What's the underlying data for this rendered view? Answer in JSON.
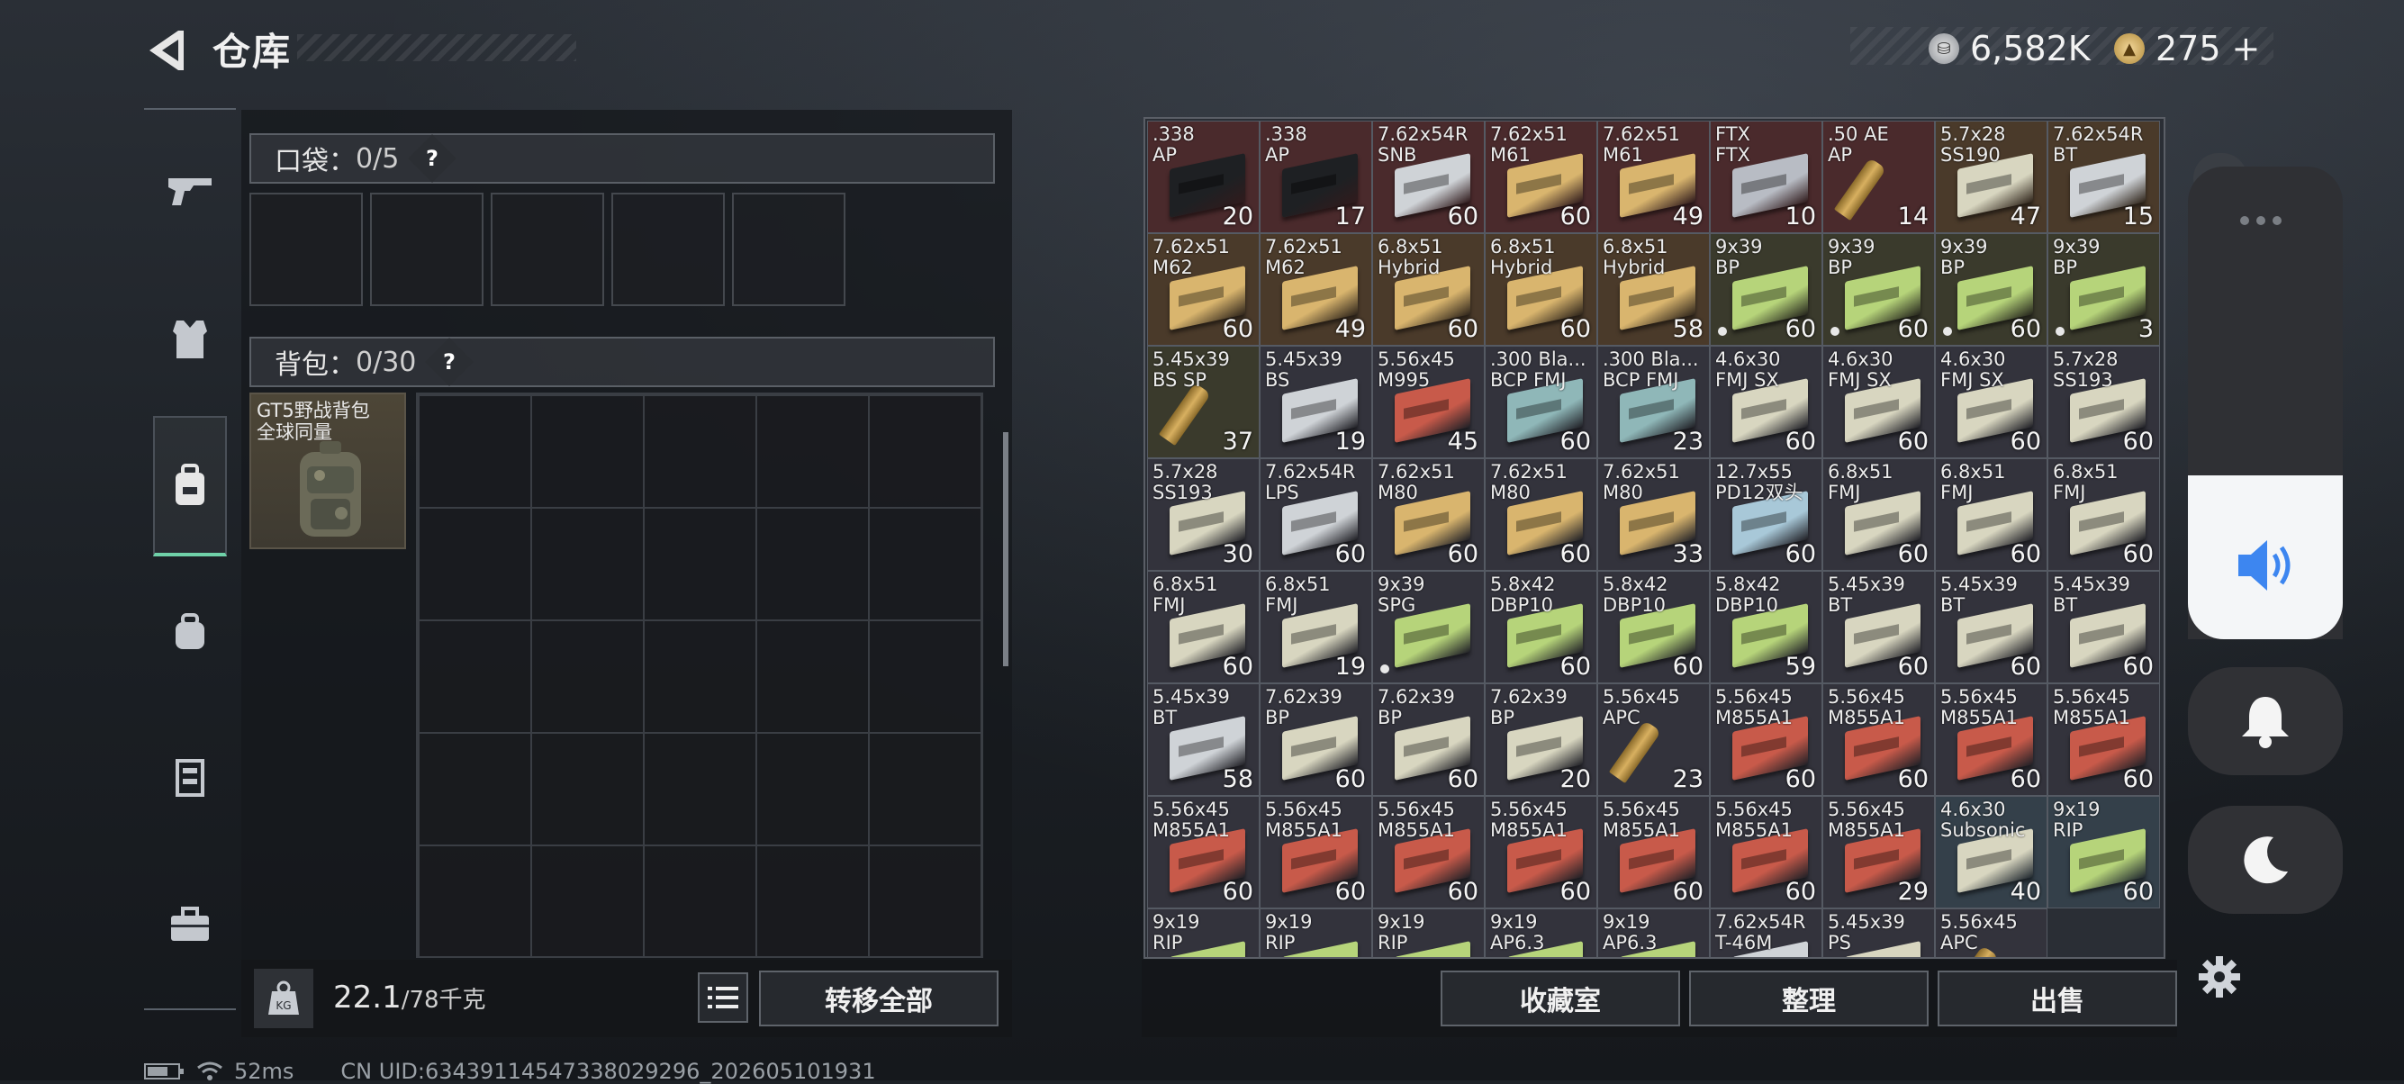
{
  "header": {
    "title": "仓库"
  },
  "currency": {
    "silver": "6,582K",
    "gold": "275",
    "plus": "+"
  },
  "pocket": {
    "label": "口袋：",
    "count": "0/5",
    "help": "?"
  },
  "backpack": {
    "label": "背包：",
    "count": "0/30",
    "help": "?",
    "item_name": "GT5野战背包\n全球同量"
  },
  "weight": {
    "current": "22.1",
    "max": "/78千克"
  },
  "buttons": {
    "transfer_all": "转移全部",
    "collection": "收藏室",
    "sort": "整理",
    "sell": "出售"
  },
  "status": {
    "ping": "52ms",
    "uid": "CN UID:634391145473380292​96_202605101931"
  },
  "ammo": [
    {
      "name": ".338\nAP",
      "count": "20",
      "color": "#1e2023",
      "bg": "#4a2a2c"
    },
    {
      "name": ".338\nAP",
      "count": "17",
      "color": "#1e2023",
      "bg": "#4a2a2c"
    },
    {
      "name": "7.62x54R\nSNB",
      "count": "60",
      "color": "#cfd3d7",
      "bg": "#4a2a2c"
    },
    {
      "name": "7.62x51\nM61",
      "count": "60",
      "color": "#d9b56e",
      "bg": "#4a2a2c"
    },
    {
      "name": "7.62x51\nM61",
      "count": "49",
      "color": "#d9b56e",
      "bg": "#4a2a2c"
    },
    {
      "name": "FTX\nFTX",
      "count": "10",
      "color": "#b8bcc4",
      "bg": "#4a2a2c"
    },
    {
      "name": ".50 AE\nAP",
      "count": "14",
      "color": "round",
      "bg": "#4a2a2c"
    },
    {
      "name": "5.7x28\nSS190",
      "count": "47",
      "color": "#d8d6c0",
      "bg": "#4a3a2a"
    },
    {
      "name": "7.62x54R\nBT",
      "count": "15",
      "color": "#cfd3d7",
      "bg": "#4a3a2a"
    },
    {
      "name": "7.62x51\nM62",
      "count": "60",
      "color": "#d9b56e",
      "bg": "#4a3a2a"
    },
    {
      "name": "7.62x51\nM62",
      "count": "49",
      "color": "#d9b56e",
      "bg": "#4a3a2a"
    },
    {
      "name": "6.8x51\nHybrid",
      "count": "60",
      "color": "#d9b56e",
      "bg": "#4a3a2a"
    },
    {
      "name": "6.8x51\nHybrid",
      "count": "60",
      "color": "#d9b56e",
      "bg": "#4a3a2a"
    },
    {
      "name": "6.8x51\nHybrid",
      "count": "58",
      "color": "#d9b56e",
      "bg": "#4a3a2a"
    },
    {
      "name": "9x39\nBP",
      "count": "60",
      "color": "#b6d47a",
      "bg": "#3a3a2c",
      "dot": true
    },
    {
      "name": "9x39\nBP",
      "count": "60",
      "color": "#b6d47a",
      "bg": "#3a3a2c",
      "dot": true
    },
    {
      "name": "9x39\nBP",
      "count": "60",
      "color": "#b6d47a",
      "bg": "#3a3a2c",
      "dot": true
    },
    {
      "name": "9x39\nBP",
      "count": "3",
      "color": "#b6d47a",
      "bg": "#3a3a2c",
      "dot": true
    },
    {
      "name": "5.45x39\nBS SP",
      "count": "37",
      "color": "round",
      "bg": "#3a3a2c"
    },
    {
      "name": "5.45x39\nBS",
      "count": "19",
      "color": "#cfd3d7",
      "bg": "#33333c"
    },
    {
      "name": "5.56x45\nM995",
      "count": "45",
      "color": "#c85a4a",
      "bg": "#33333c"
    },
    {
      "name": ".300 Bla...\nBCP FMJ",
      "count": "60",
      "color": "#8fb7b8",
      "bg": "#33333c"
    },
    {
      "name": ".300 Bla...\nBCP FMJ",
      "count": "23",
      "color": "#8fb7b8",
      "bg": "#33333c"
    },
    {
      "name": "4.6x30\nFMJ SX",
      "count": "60",
      "color": "#d8d6c0",
      "bg": "#33333c"
    },
    {
      "name": "4.6x30\nFMJ SX",
      "count": "60",
      "color": "#d8d6c0",
      "bg": "#33333c"
    },
    {
      "name": "4.6x30\nFMJ SX",
      "count": "60",
      "color": "#d8d6c0",
      "bg": "#33333c"
    },
    {
      "name": "5.7x28\nSS193",
      "count": "60",
      "color": "#d8d6c0",
      "bg": "#33333c"
    },
    {
      "name": "5.7x28\nSS193",
      "count": "30",
      "color": "#d8d6c0",
      "bg": "#33333c"
    },
    {
      "name": "7.62x54R\nLPS",
      "count": "60",
      "color": "#cfd3d7",
      "bg": "#33333c"
    },
    {
      "name": "7.62x51\nM80",
      "count": "60",
      "color": "#d9b56e",
      "bg": "#33333c"
    },
    {
      "name": "7.62x51\nM80",
      "count": "60",
      "color": "#d9b56e",
      "bg": "#33333c"
    },
    {
      "name": "7.62x51\nM80",
      "count": "33",
      "color": "#d9b56e",
      "bg": "#33333c"
    },
    {
      "name": "12.7x55\nPD12双头",
      "count": "60",
      "color": "#a8c8d8",
      "bg": "#33333c"
    },
    {
      "name": "6.8x51\nFMJ",
      "count": "60",
      "color": "#d8d6c0",
      "bg": "#33333c"
    },
    {
      "name": "6.8x51\nFMJ",
      "count": "60",
      "color": "#d8d6c0",
      "bg": "#33333c"
    },
    {
      "name": "6.8x51\nFMJ",
      "count": "60",
      "color": "#d8d6c0",
      "bg": "#33333c"
    },
    {
      "name": "6.8x51\nFMJ",
      "count": "60",
      "color": "#d8d6c0",
      "bg": "#33333c"
    },
    {
      "name": "6.8x51\nFMJ",
      "count": "19",
      "color": "#d8d6c0",
      "bg": "#33333c"
    },
    {
      "name": "9x39\nSPG",
      "count": "",
      "color": "#b6d47a",
      "bg": "#33333c",
      "dot": true
    },
    {
      "name": "5.8x42\nDBP10",
      "count": "60",
      "color": "#b6d47a",
      "bg": "#33333c"
    },
    {
      "name": "5.8x42\nDBP10",
      "count": "60",
      "color": "#b6d47a",
      "bg": "#33333c"
    },
    {
      "name": "5.8x42\nDBP10",
      "count": "59",
      "color": "#b6d47a",
      "bg": "#33333c"
    },
    {
      "name": "5.45x39\nBT",
      "count": "60",
      "color": "#d8d6c0",
      "bg": "#33333c"
    },
    {
      "name": "5.45x39\nBT",
      "count": "60",
      "color": "#d8d6c0",
      "bg": "#33333c"
    },
    {
      "name": "5.45x39\nBT",
      "count": "60",
      "color": "#d8d6c0",
      "bg": "#33333c"
    },
    {
      "name": "5.45x39\nBT",
      "count": "58",
      "color": "#cfd3d7",
      "bg": "#33333c"
    },
    {
      "name": "7.62x39\nBP",
      "count": "60",
      "color": "#d8d6c0",
      "bg": "#33333c"
    },
    {
      "name": "7.62x39\nBP",
      "count": "60",
      "color": "#d8d6c0",
      "bg": "#33333c"
    },
    {
      "name": "7.62x39\nBP",
      "count": "20",
      "color": "#d8d6c0",
      "bg": "#33333c"
    },
    {
      "name": "5.56x45\nAPC",
      "count": "23",
      "color": "round",
      "bg": "#33333c"
    },
    {
      "name": "5.56x45\nM855A1",
      "count": "60",
      "color": "#c85a4a",
      "bg": "#33333c"
    },
    {
      "name": "5.56x45\nM855A1",
      "count": "60",
      "color": "#c85a4a",
      "bg": "#33333c"
    },
    {
      "name": "5.56x45\nM855A1",
      "count": "60",
      "color": "#c85a4a",
      "bg": "#33333c"
    },
    {
      "name": "5.56x45\nM855A1",
      "count": "60",
      "color": "#c85a4a",
      "bg": "#33333c"
    },
    {
      "name": "5.56x45\nM855A1",
      "count": "60",
      "color": "#c85a4a",
      "bg": "#33333c"
    },
    {
      "name": "5.56x45\nM855A1",
      "count": "60",
      "color": "#c85a4a",
      "bg": "#33333c"
    },
    {
      "name": "5.56x45\nM855A1",
      "count": "60",
      "color": "#c85a4a",
      "bg": "#33333c"
    },
    {
      "name": "5.56x45\nM855A1",
      "count": "60",
      "color": "#c85a4a",
      "bg": "#33333c"
    },
    {
      "name": "5.56x45\nM855A1",
      "count": "60",
      "color": "#c85a4a",
      "bg": "#33333c"
    },
    {
      "name": "5.56x45\nM855A1",
      "count": "60",
      "color": "#c85a4a",
      "bg": "#33333c"
    },
    {
      "name": "5.56x45\nM855A1",
      "count": "29",
      "color": "#c85a4a",
      "bg": "#33333c"
    },
    {
      "name": "4.6x30\nSubsonic",
      "count": "40",
      "color": "#d8d6c0",
      "bg": "#34404a"
    },
    {
      "name": "9x19\nRIP",
      "count": "60",
      "color": "#b6d47a",
      "bg": "#34404a"
    },
    {
      "name": "9x19\nRIP",
      "count": "",
      "color": "#b6d47a",
      "bg": "#33333c"
    },
    {
      "name": "9x19\nRIP",
      "count": "",
      "color": "#b6d47a",
      "bg": "#33333c"
    },
    {
      "name": "9x19\nRIP",
      "count": "",
      "color": "#b6d47a",
      "bg": "#33333c"
    },
    {
      "name": "9x19\nAP6.3",
      "count": "",
      "color": "#b6d47a",
      "bg": "#33333c"
    },
    {
      "name": "9x19\nAP6.3",
      "count": "",
      "color": "#b6d47a",
      "bg": "#33333c"
    },
    {
      "name": "7.62x54R\nT-46M",
      "count": "",
      "color": "#cfd3d7",
      "bg": "#33333c"
    },
    {
      "name": "5.45x39\nPS",
      "count": "",
      "color": "#d8d6c0",
      "bg": "#33333c"
    },
    {
      "name": "5.56x45\nAPC",
      "count": "",
      "color": "round",
      "bg": "#33333c"
    }
  ]
}
